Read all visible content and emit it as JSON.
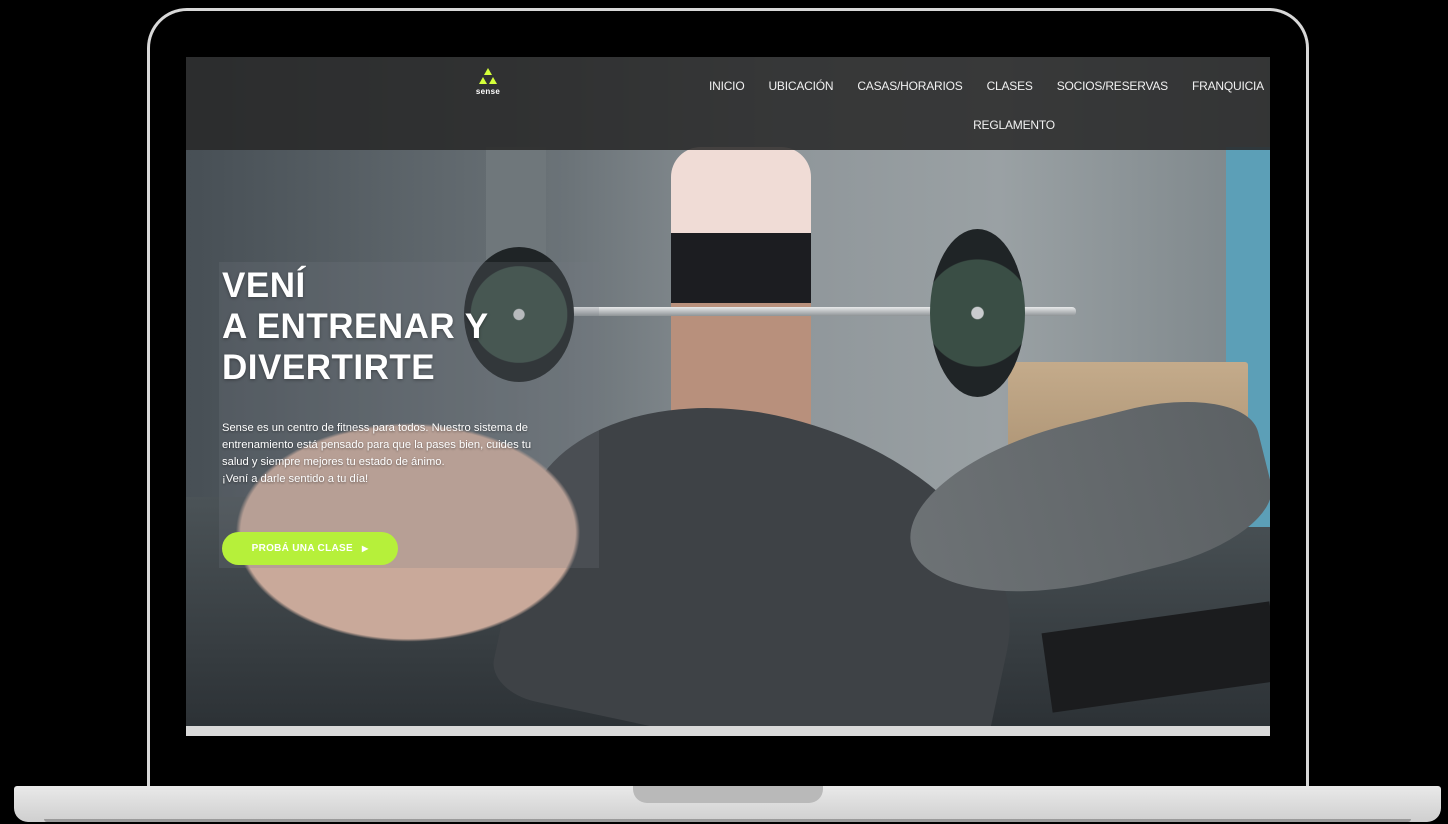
{
  "site": {
    "logo_text": "sense",
    "colors": {
      "accent": "#b6f03a",
      "header_bg": "#282828",
      "logo_mark": "#d4ff3a"
    }
  },
  "nav": {
    "items": [
      {
        "label": "INICIO"
      },
      {
        "label": "UBICACIÓN"
      },
      {
        "label": "CASAS/HORARIOS"
      },
      {
        "label": "CLASES"
      },
      {
        "label": "SOCIOS/RESERVAS"
      },
      {
        "label": "FRANQUICIA"
      },
      {
        "label": "REGLAMENTO"
      }
    ]
  },
  "hero": {
    "title_lines": [
      "VENÍ",
      "A ENTRENAR Y",
      "DIVERTIRTE"
    ],
    "description_lines": [
      "Sense es un centro de fitness para todos. Nuestro sistema de",
      "entrenamiento está pensado para que la pases bien, cuides tu",
      "salud y siempre mejores tu estado de ánimo.",
      "¡Vení a darle sentido a tu día!"
    ],
    "cta_label": "PROBÁ UNA CLASE",
    "cta_icon": "chevron-right-icon"
  }
}
